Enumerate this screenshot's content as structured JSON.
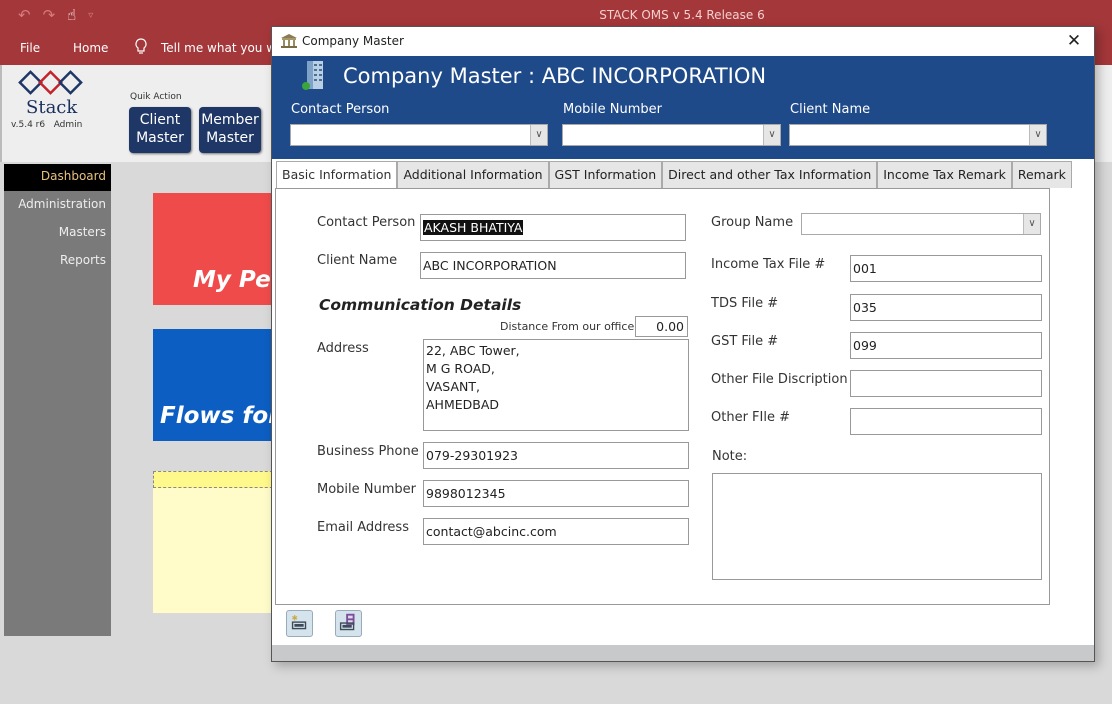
{
  "app": {
    "title": "STACK OMS v 5.4 Release 6",
    "ribbon_tabs": [
      "File",
      "Home"
    ],
    "tell_me": "Tell me what you want to do",
    "tell_me_visible": "Tell me what you wa"
  },
  "brand": {
    "logo_text": "Stack",
    "version": "v.5.4 r6",
    "role": "Admin"
  },
  "quick_action": {
    "label": "Quik Action",
    "buttons": [
      {
        "line1": "Client",
        "line2": "Master"
      },
      {
        "line1": "Member",
        "line2": "Master"
      }
    ]
  },
  "nav": {
    "items": [
      {
        "label": "Dashboard",
        "active": true
      },
      {
        "label": "Administration",
        "active": false
      },
      {
        "label": "Masters",
        "active": false
      },
      {
        "label": "Reports",
        "active": false
      }
    ]
  },
  "tiles": [
    {
      "label": "My Pe",
      "color": "#f04b4b"
    },
    {
      "label": "Flows for",
      "color": "#0c5ec2"
    },
    {
      "label": "",
      "color": "#fffcc9"
    }
  ],
  "dialog": {
    "window_title": "Company Master",
    "close_icon": "close-icon",
    "heading": "Company Master : ABC INCORPORATION",
    "filters": [
      {
        "label": "Contact Person",
        "value": ""
      },
      {
        "label": "Mobile Number",
        "value": ""
      },
      {
        "label": "Client Name",
        "value": ""
      }
    ],
    "tabs": [
      {
        "label": "Basic Information",
        "active": true
      },
      {
        "label": "Additional Information",
        "active": false
      },
      {
        "label": "GST Information",
        "active": false
      },
      {
        "label": "Direct and other Tax Information",
        "active": false
      },
      {
        "label": "Income Tax Remark",
        "active": false
      },
      {
        "label": "Remark",
        "active": false
      }
    ],
    "basic": {
      "contact_person_label": "Contact Person",
      "contact_person": "AKASH BHATIYA",
      "client_name_label": "Client Name",
      "client_name": "ABC INCORPORATION",
      "section_title": "Communication Details",
      "distance_label": "Distance From our office:",
      "distance": "0.00",
      "address_label": "Address",
      "address_lines": [
        "22, ABC Tower,",
        "M G ROAD,",
        "VASANT,",
        "AHMEDBAD"
      ],
      "business_phone_label": "Business Phone",
      "business_phone": "079-29301923",
      "mobile_label": "Mobile Number",
      "mobile": "9898012345",
      "email_label": "Email Address",
      "email": "contact@abcinc.com",
      "group_name_label": "Group Name",
      "group_name": "",
      "income_tax_label": "Income Tax File #",
      "income_tax": "001",
      "tds_label": "TDS File #",
      "tds": "035",
      "gst_label": "GST File #",
      "gst": "099",
      "other_desc_label": "Other File Discription",
      "other_desc": "",
      "other_file_label": "Other FIle #",
      "other_file": "",
      "note_label": "Note:",
      "note": ""
    },
    "footer_buttons": [
      {
        "name": "new-record-button",
        "icon": "new-record-icon"
      },
      {
        "name": "save-record-button",
        "icon": "save-icon"
      }
    ]
  }
}
